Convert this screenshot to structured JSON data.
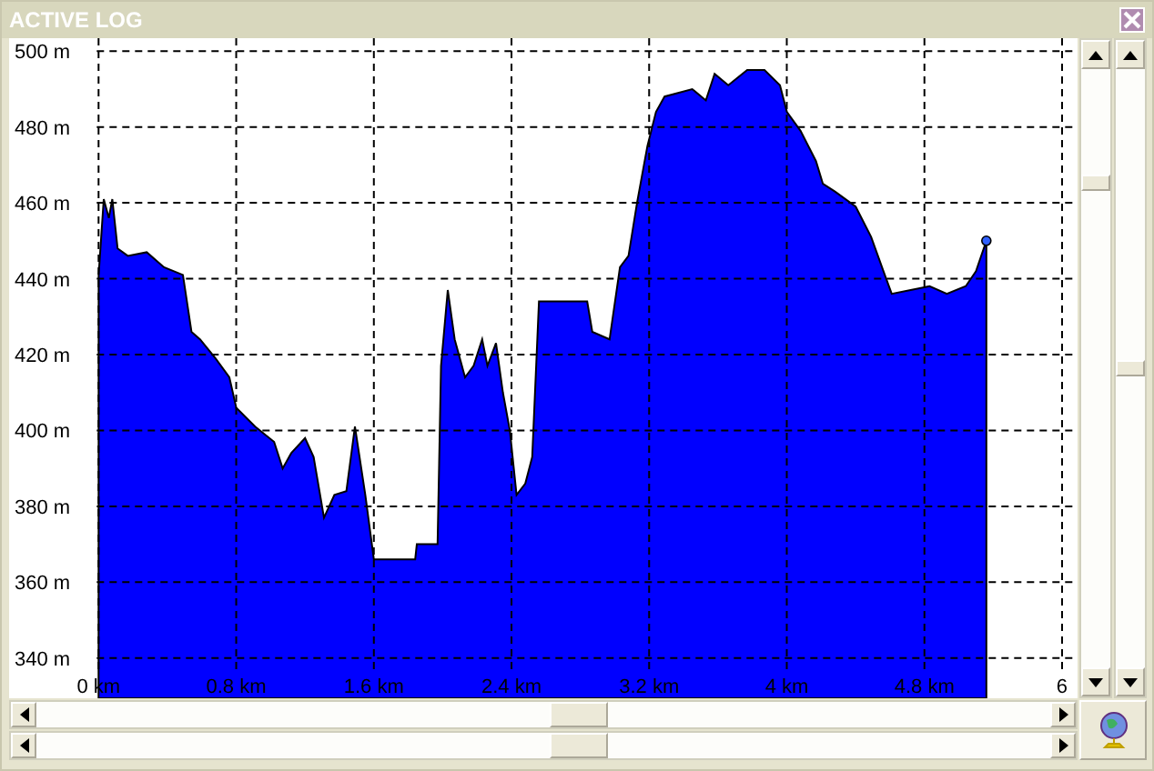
{
  "window": {
    "title": "ACTIVE LOG"
  },
  "chart_data": {
    "type": "area",
    "xlim": [
      -0.52,
      5.69
    ],
    "ylim": [
      329.4,
      503.4
    ],
    "yticks": [
      {
        "value": 500,
        "label": "500 m"
      },
      {
        "value": 480,
        "label": "480 m"
      },
      {
        "value": 460,
        "label": "460 m"
      },
      {
        "value": 440,
        "label": "440 m"
      },
      {
        "value": 420,
        "label": "420 m"
      },
      {
        "value": 400,
        "label": "400 m"
      },
      {
        "value": 380,
        "label": "380 m"
      },
      {
        "value": 360,
        "label": "360 m"
      },
      {
        "value": 340,
        "label": "340 m"
      }
    ],
    "xticks": [
      {
        "value": 0,
        "label": "0 km"
      },
      {
        "value": 0.8,
        "label": "0.8 km"
      },
      {
        "value": 1.6,
        "label": "1.6 km"
      },
      {
        "value": 2.4,
        "label": "2.4 km"
      },
      {
        "value": 3.2,
        "label": "3.2 km"
      },
      {
        "value": 4,
        "label": "4 km"
      },
      {
        "value": 4.8,
        "label": "4.8 km"
      },
      {
        "value": 5.6,
        "label": "6"
      }
    ],
    "x": [
      0,
      0.03,
      0.06,
      0.08,
      0.11,
      0.17,
      0.28,
      0.38,
      0.49,
      0.54,
      0.59,
      0.68,
      0.76,
      0.8,
      0.91,
      1.02,
      1.07,
      1.12,
      1.2,
      1.25,
      1.31,
      1.37,
      1.44,
      1.49,
      1.55,
      1.6,
      1.65,
      1.84,
      1.85,
      1.97,
      1.99,
      2.03,
      2.07,
      2.13,
      2.18,
      2.23,
      2.26,
      2.31,
      2.35,
      2.39,
      2.43,
      2.48,
      2.52,
      2.56,
      2.6,
      2.84,
      2.87,
      2.97,
      3.03,
      3.08,
      3.13,
      3.19,
      3.24,
      3.29,
      3.45,
      3.53,
      3.58,
      3.66,
      3.77,
      3.87,
      3.96,
      4.0,
      4.08,
      4.17,
      4.21,
      4.28,
      4.4,
      4.49,
      4.57,
      4.61,
      4.72,
      4.83,
      4.93,
      5.04,
      5.1,
      5.16
    ],
    "grid": true,
    "series": [
      {
        "color": "#0000ff",
        "values": [
          441,
          461,
          456,
          461,
          448,
          446,
          447,
          443,
          441,
          426,
          424,
          419,
          414,
          406,
          401,
          397,
          390,
          394,
          398,
          393,
          377,
          383,
          384,
          401,
          383,
          366,
          366,
          366,
          370,
          370,
          417,
          437,
          424,
          414,
          417,
          424,
          417,
          423,
          410,
          400,
          383,
          386,
          393,
          434,
          434,
          434,
          426,
          424,
          443,
          446,
          460,
          475,
          484,
          488,
          490,
          487,
          494,
          491,
          495,
          495,
          491,
          484,
          479,
          471,
          465,
          463,
          459,
          451,
          441,
          436,
          437,
          438,
          436,
          438,
          442,
          450
        ]
      }
    ]
  }
}
